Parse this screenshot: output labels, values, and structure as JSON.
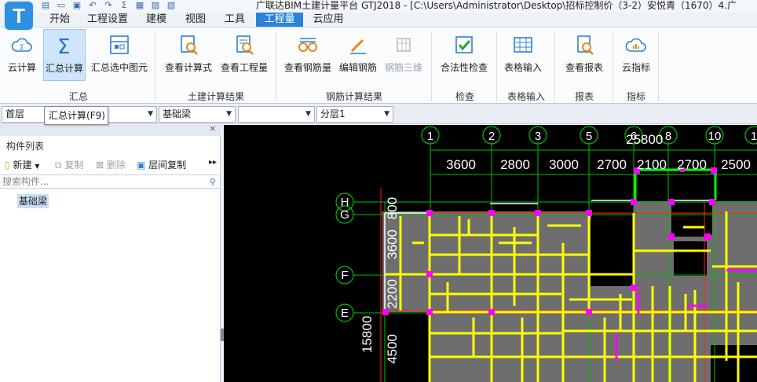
{
  "app": {
    "logo": "T",
    "title": "广联达BIM土建计量平台 GTJ2018 - [C:\\Users\\Administrator\\Desktop\\招标控制价（3-2）安悦青（1670）4.广"
  },
  "menu": {
    "tabs": [
      {
        "label": "开始"
      },
      {
        "label": "工程设置"
      },
      {
        "label": "建模"
      },
      {
        "label": "视图"
      },
      {
        "label": "工具"
      },
      {
        "label": "工程量"
      },
      {
        "label": "云应用"
      }
    ]
  },
  "ribbon": {
    "buttons": [
      {
        "label": "云计算",
        "icon": "cloud-sigma-icon"
      },
      {
        "label": "汇总计算",
        "icon": "sigma-icon"
      },
      {
        "label": "汇总选中图元",
        "icon": "sum-selected-icon"
      },
      {
        "label": "查看计算式",
        "icon": "formula-magnifier-icon"
      },
      {
        "label": "查看工程量",
        "icon": "quantity-magnifier-icon"
      },
      {
        "label": "查看钢筋量",
        "icon": "rebar-glasses-icon"
      },
      {
        "label": "编辑钢筋",
        "icon": "pencil-icon"
      },
      {
        "label": "钢筋三维",
        "icon": "rebar-3d-icon"
      },
      {
        "label": "合法性检查",
        "icon": "check-icon"
      },
      {
        "label": "表格输入",
        "icon": "table-icon"
      },
      {
        "label": "查看报表",
        "icon": "report-icon"
      },
      {
        "label": "云指标",
        "icon": "cloud-chart-icon"
      }
    ],
    "groups": [
      {
        "label": "汇总"
      },
      {
        "label": "土建计算结果"
      },
      {
        "label": "钢筋计算结果"
      },
      {
        "label": "检查"
      },
      {
        "label": "表格输入"
      },
      {
        "label": "报表"
      },
      {
        "label": "指标"
      }
    ]
  },
  "toolbar": {
    "floor": "首层",
    "tooltip": "汇总计算(F9)",
    "component_type": "基础梁",
    "blank_select": "",
    "layer": "分层1"
  },
  "left_panel": {
    "title": "构件列表",
    "new_label": "新建",
    "copy_label": "复制",
    "delete_label": "删除",
    "floor_copy_label": "层间复制",
    "search_placeholder": "搜索构件...",
    "items": [
      {
        "label": "基础梁"
      }
    ]
  },
  "drawing": {
    "total_width": "25800",
    "total_height": "15800",
    "col_axes": [
      "1",
      "2",
      "3",
      "5",
      "6",
      "8",
      "10",
      "1"
    ],
    "col_dims": [
      "3600",
      "2800",
      "3000",
      "2700",
      "2100",
      "2700",
      "2500"
    ],
    "row_axes": [
      "H",
      "G",
      "F",
      "E"
    ],
    "row_dims": [
      "800",
      "3600",
      "2200",
      "4500"
    ],
    "colors": {
      "background": "#000000",
      "grid": "#00c000",
      "beam": "#ffff00",
      "slab": "#6e6e6e",
      "column": "#ff00ff",
      "axis_red": "#ff2020"
    }
  }
}
